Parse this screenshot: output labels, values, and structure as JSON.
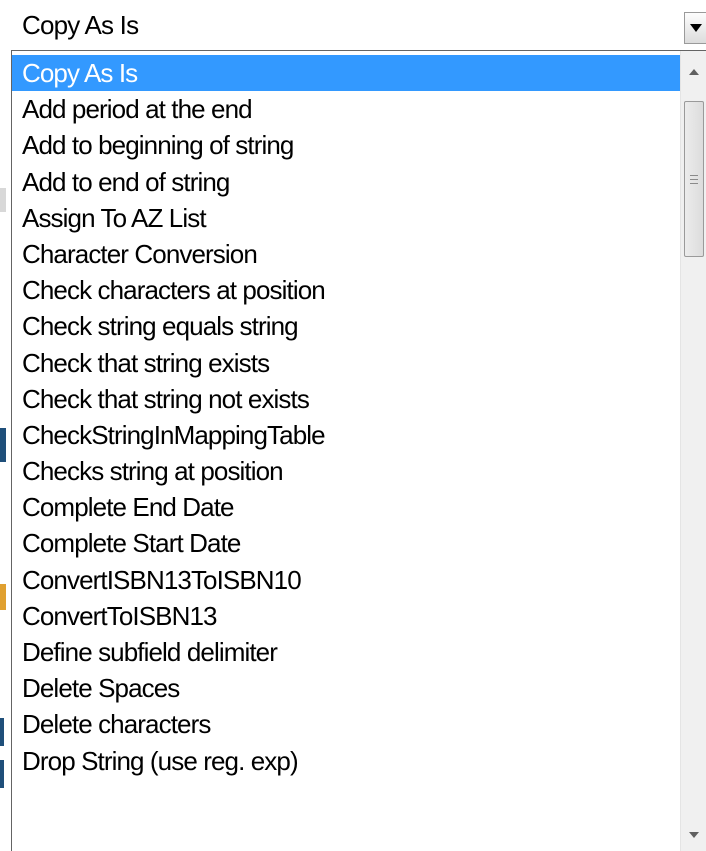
{
  "combo": {
    "selected_value": "Copy As Is",
    "arrow_icon": "chevron-down-icon"
  },
  "dropdown": {
    "selected_index": 0,
    "items": [
      "Copy As Is",
      "Add period at the end",
      "Add to beginning of string",
      "Add to end of string",
      "Assign To AZ List",
      "Character Conversion",
      "Check characters at position",
      "Check string equals string",
      "Check that string exists",
      "Check that string not exists",
      "CheckStringInMappingTable",
      "Checks string at position",
      "Complete End Date",
      "Complete Start Date",
      "ConvertISBN13ToISBN10",
      "ConvertToISBN13",
      "Define subfield delimiter",
      "Delete Spaces",
      "Delete characters",
      "Drop String (use reg. exp)"
    ]
  },
  "scrollbar": {
    "up_icon": "scroll-up-icon",
    "down_icon": "scroll-down-icon",
    "thumb_icon": "grip-icon"
  },
  "colors": {
    "selection": "#3399ff",
    "selection_text": "#ffffff",
    "text": "#000000",
    "border": "#646464"
  }
}
